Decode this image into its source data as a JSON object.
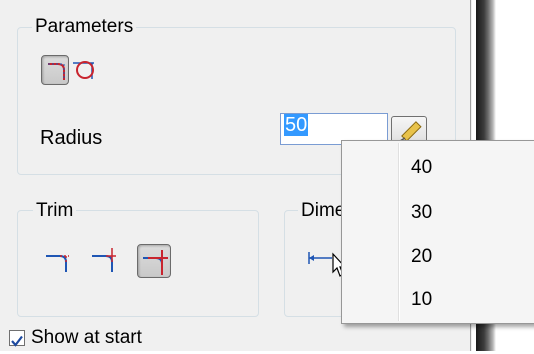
{
  "parameters": {
    "legend": "Parameters",
    "radius_label": "Radius",
    "radius_value": "50"
  },
  "trim": {
    "legend": "Trim"
  },
  "dimension": {
    "legend": "Dime"
  },
  "show_at_start": {
    "label": "Show at start",
    "checked": true
  },
  "radius_dropdown": {
    "options": [
      "40",
      "30",
      "20",
      "10"
    ]
  },
  "icons": [
    "fillet-corner-icon",
    "fillet-circle-icon",
    "measure-ruler-icon",
    "trim-none-icon",
    "trim-one-icon",
    "trim-both-icon",
    "dimension-icon",
    "checkmark-icon",
    "cursor-move-icon"
  ],
  "colors": {
    "selection": "#3399ff",
    "icon_blue": "#1f56b4",
    "icon_red": "#c8242e"
  }
}
